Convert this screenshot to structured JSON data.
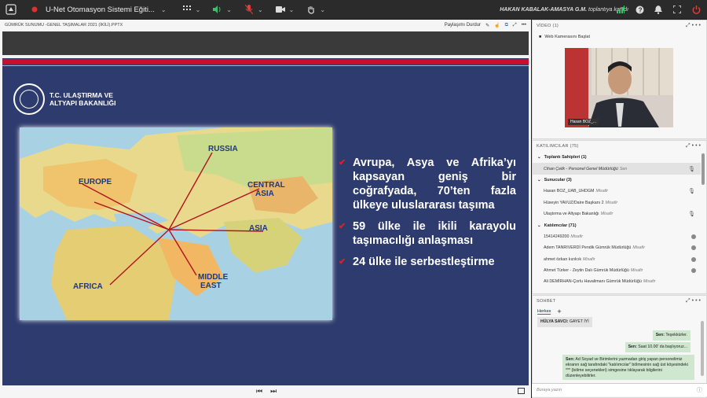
{
  "topbar": {
    "meeting_title": "U-Net Otomasyon Sistemi Eğiti...",
    "host": "HAKAN KABALAK-AMASYA G.M.",
    "host_suffix": "toplantıya katıldı"
  },
  "share": {
    "file_title": "GÜMRÜK SUNUMU -GENEL TAŞIMALAR 2021 (İKİLİ).PPTX",
    "stop_label": "Paylaşımı Durdur"
  },
  "slide": {
    "org_line1": "T.C. ULAŞTIRMA VE",
    "org_line2": "ALTYAPI BAKANLIĞI",
    "map_labels": {
      "russia": "RUSSIA",
      "europe": "EUROPE",
      "central_asia_1": "CENTRAL",
      "central_asia_2": "ASIA",
      "asia": "ASIA",
      "africa": "AFRICA",
      "middle_east_1": "MIDDLE",
      "middle_east_2": "EAST"
    },
    "bullets": [
      "Avrupa, Asya ve Afrika’yı kapsayan geniş bir coğrafyada, 70’ten fazla ülkeye uluslararası taşıma",
      "59 ülke ile ikili karayolu taşımacılığı anlaşması",
      "24 ülke ile serbestleştirme"
    ]
  },
  "video": {
    "header": "VİDEO (1)",
    "webcam_button": "Web Kamerasını Başlat",
    "participant_name": "Hasan BOZ_..."
  },
  "participants": {
    "header": "KATILIMCILAR (75)",
    "hosts_section": "Toplantı Sahipleri (1)",
    "presenters_section": "Sunucular (3)",
    "attendees_section": "Katılımcılar (71)",
    "hosts": [
      {
        "name": "Cihan Çelik - Personel Genel Müdürlüğü",
        "role": "Sen"
      }
    ],
    "presenters": [
      {
        "name": "Hasan BOZ_UAB_UHDGM",
        "role": "Misafir"
      },
      {
        "name": "Hüseyin YAVUZ/Daire Başkanı 2",
        "role": "Misafir"
      },
      {
        "name": "Ulaştırma ve Altyapı Bakanlığı",
        "role": "Misafir"
      }
    ],
    "attendees": [
      {
        "name": "15414249200",
        "role": "Misafir"
      },
      {
        "name": "Adem TANRIVERDİ Pendik Gümrük Müdürlüğü",
        "role": "Misafir"
      },
      {
        "name": "ahmet özkan kızılcık",
        "role": "Misafir"
      },
      {
        "name": "Ahmet Türker - Zeytin Dalı Gümrük Müdürlüğü",
        "role": "Misafir"
      },
      {
        "name": "Ali DEMİRHAN-Çorlu Havalimanı Gümrük Müdürlüğü",
        "role": "Misafir"
      }
    ]
  },
  "chat": {
    "header": "SOHBET",
    "tab_all": "Herkes",
    "messages": [
      {
        "sender": "HÜLYA SAVCI:",
        "text": "GAYET İYİ",
        "dir": "in"
      },
      {
        "sender": "Sen:",
        "text": "Teşekkürler.",
        "dir": "out"
      },
      {
        "sender": "Sen:",
        "text": "Saat 10.00' da başlıyoruz...",
        "dir": "out"
      },
      {
        "sender": "Sen:",
        "text": "Ad Soyad ve Birimlerini yazmadan giriş yapan personelimiz ekranın sağ tarafındaki \"katılımcılar\" bölmesinin sağ üst köşesindeki *** (bölme seçenekleri) simgesine tıklayarak bilgilerini düzenleyebilirler.",
        "dir": "out"
      }
    ],
    "input_placeholder": "Buraya yazın"
  }
}
